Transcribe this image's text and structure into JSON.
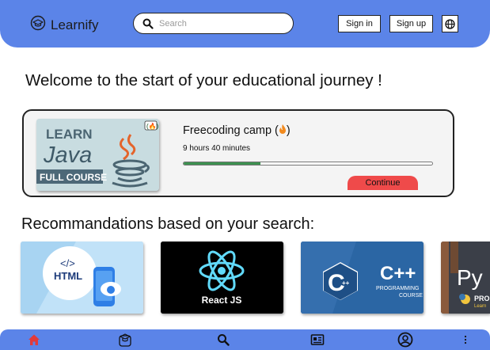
{
  "header": {
    "brand": "Learnify",
    "search_placeholder": "Search",
    "sign_in": "Sign in",
    "sign_up": "Sign up"
  },
  "main": {
    "welcome": "Welcome to the start of your educational journey !",
    "current_course": {
      "title": "Freecoding camp (",
      "title_end": ")",
      "duration": "9 hours 40 minutes",
      "progress": 0.31,
      "continue_label": "Continue",
      "thumbnail": {
        "line1": "LEARN",
        "line2": "Java",
        "line3": "FULL COURSE"
      }
    },
    "recommendations_title": "Recommandations based on your search:",
    "recommendations": [
      {
        "label": "HTML",
        "code_tag": "</>"
      },
      {
        "label": "React JS"
      },
      {
        "label": "C++",
        "sub1": "PROGRAMMING",
        "sub2": "COURSE"
      },
      {
        "label": "Py",
        "sub1": "PRO",
        "sub2": "Learn"
      }
    ]
  },
  "colors": {
    "accent": "#5b84e8",
    "continue": "#ef4a4a",
    "progress": "#3d9150",
    "active_nav": "#e23a3a"
  },
  "nav": {
    "items": [
      "home-icon",
      "graduation-cap-icon",
      "search-icon",
      "news-icon",
      "profile-icon",
      "more-icon"
    ],
    "active": "home-icon"
  }
}
